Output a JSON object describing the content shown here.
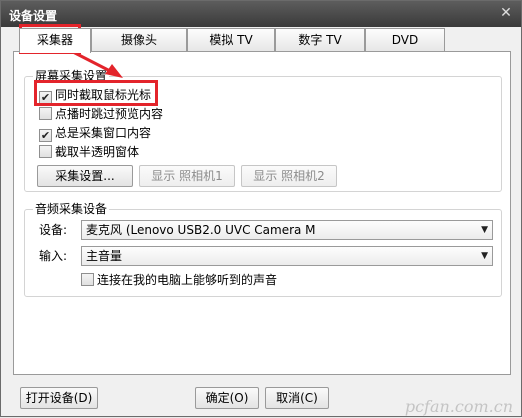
{
  "window": {
    "title": "设备设置",
    "close_glyph": "✕"
  },
  "tabs": [
    {
      "label": "采集器",
      "active": true
    },
    {
      "label": "摄像头",
      "active": false
    },
    {
      "label": "模拟 TV",
      "active": false
    },
    {
      "label": "数字 TV",
      "active": false
    },
    {
      "label": "DVD",
      "active": false
    }
  ],
  "screen_capture": {
    "title": "屏幕采集设置",
    "options": [
      {
        "label": "同时截取鼠标光标",
        "checked": true
      },
      {
        "label": "点播时跳过预览内容",
        "checked": false
      },
      {
        "label": "总是采集窗口内容",
        "checked": true
      },
      {
        "label": "截取半透明窗体",
        "checked": false
      }
    ],
    "buttons": {
      "settings": "采集设置...",
      "show_camera1": "显示 照相机1",
      "show_camera2": "显示 照相机2"
    }
  },
  "audio_capture": {
    "title": "音频采集设备",
    "device_label": "设备:",
    "device_value": "麦克风 (Lenovo USB2.0 UVC Camera M",
    "input_label": "输入:",
    "input_value": "主音量",
    "loopback_label": "连接在我的电脑上能够听到的声音",
    "loopback_checked": false
  },
  "footer": {
    "open_device": "打开设备(D)",
    "ok": "确定(O)",
    "cancel": "取消(C)"
  },
  "watermark": "pcfan.com.cn",
  "colors": {
    "highlight": "#e3242b",
    "titlebar": "#3a3a3a"
  }
}
